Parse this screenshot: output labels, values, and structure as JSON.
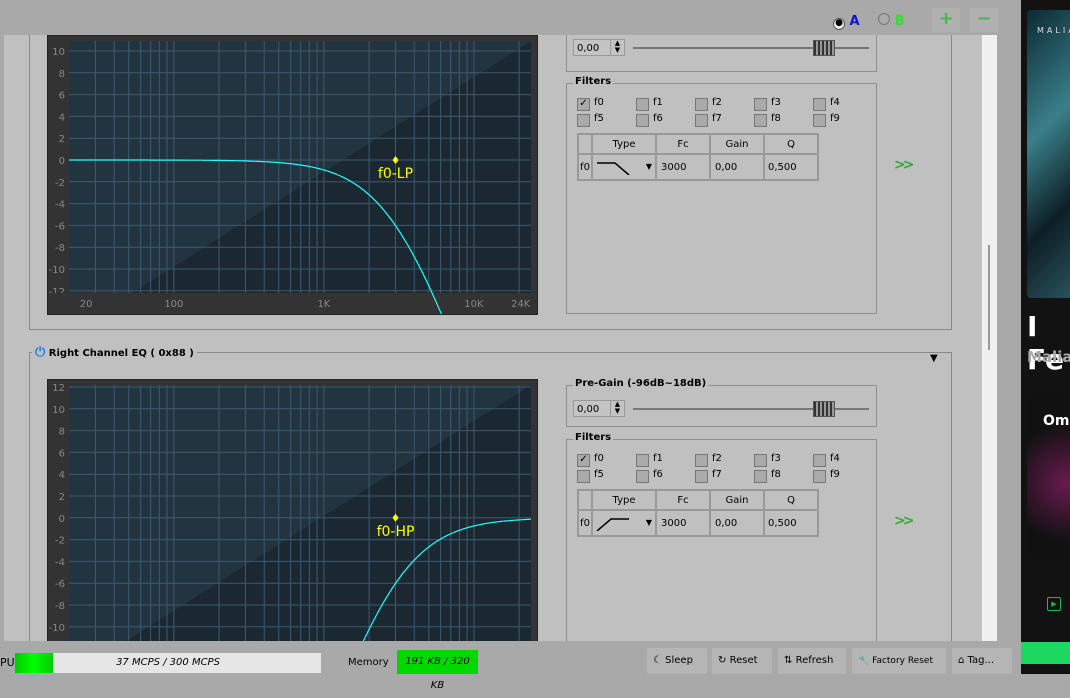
{
  "topbar": {
    "radio_a": "A",
    "radio_b": "B",
    "add": "+",
    "remove": "−",
    "selected": "A"
  },
  "left_eq": {
    "pregain_value": "0,00",
    "plot": {
      "y_ticks": [
        "10",
        "8",
        "6",
        "4",
        "2",
        "0",
        "-2",
        "-4",
        "-6",
        "-8",
        "-10",
        "-12"
      ],
      "x_ticks": [
        "20",
        "100",
        "1K",
        "10K",
        "24K"
      ],
      "marker": "f0-LP",
      "filter_type": "lowpass",
      "fc": 3000,
      "q": 0.5
    },
    "filters_label": "Filters",
    "checkboxes": [
      {
        "label": "f0",
        "checked": true
      },
      {
        "label": "f1"
      },
      {
        "label": "f2"
      },
      {
        "label": "f3"
      },
      {
        "label": "f4"
      },
      {
        "label": "f5"
      },
      {
        "label": "f6"
      },
      {
        "label": "f7"
      },
      {
        "label": "f8"
      },
      {
        "label": "f9"
      }
    ],
    "table": {
      "headers": [
        "Type",
        "Fc",
        "Gain",
        "Q"
      ],
      "row": {
        "name": "f0",
        "fc": "3000",
        "gain": "0,00",
        "q": "0,500"
      }
    }
  },
  "right_eq": {
    "title": "Right Channel EQ ( 0x88 )",
    "pregain_label": "Pre-Gain (-96dB~18dB)",
    "pregain_value": "0,00",
    "plot": {
      "y_ticks": [
        "12",
        "10",
        "8",
        "6",
        "4",
        "2",
        "0",
        "-2",
        "-4",
        "-6",
        "-8",
        "-10"
      ],
      "marker": "f0-HP",
      "filter_type": "highpass",
      "fc": 3000,
      "q": 0.5
    },
    "filters_label": "Filters",
    "checkboxes": [
      {
        "label": "f0",
        "checked": true
      },
      {
        "label": "f1"
      },
      {
        "label": "f2"
      },
      {
        "label": "f3"
      },
      {
        "label": "f4"
      },
      {
        "label": "f5"
      },
      {
        "label": "f6"
      },
      {
        "label": "f7"
      },
      {
        "label": "f8"
      },
      {
        "label": "f9"
      }
    ],
    "table": {
      "headers": [
        "Type",
        "Fc",
        "Gain",
        "Q"
      ],
      "row": {
        "name": "f0",
        "fc": "3000",
        "gain": "0,00",
        "q": "0,500"
      }
    }
  },
  "status": {
    "cpu_label": "PU",
    "cpu_text": "37 MCPS / 300 MCPS",
    "cpu_fraction": 0.123,
    "memory_label": "Memory",
    "memory_text": "191 KB / 320 KB",
    "buttons": [
      "Sleep",
      "Reset",
      "Refresh",
      "Factory Reset",
      "Tag..."
    ]
  },
  "side_app": {
    "artist_top": "MALIA",
    "title": "I Fe",
    "subtitle": "Malia,",
    "card": "Om"
  }
}
